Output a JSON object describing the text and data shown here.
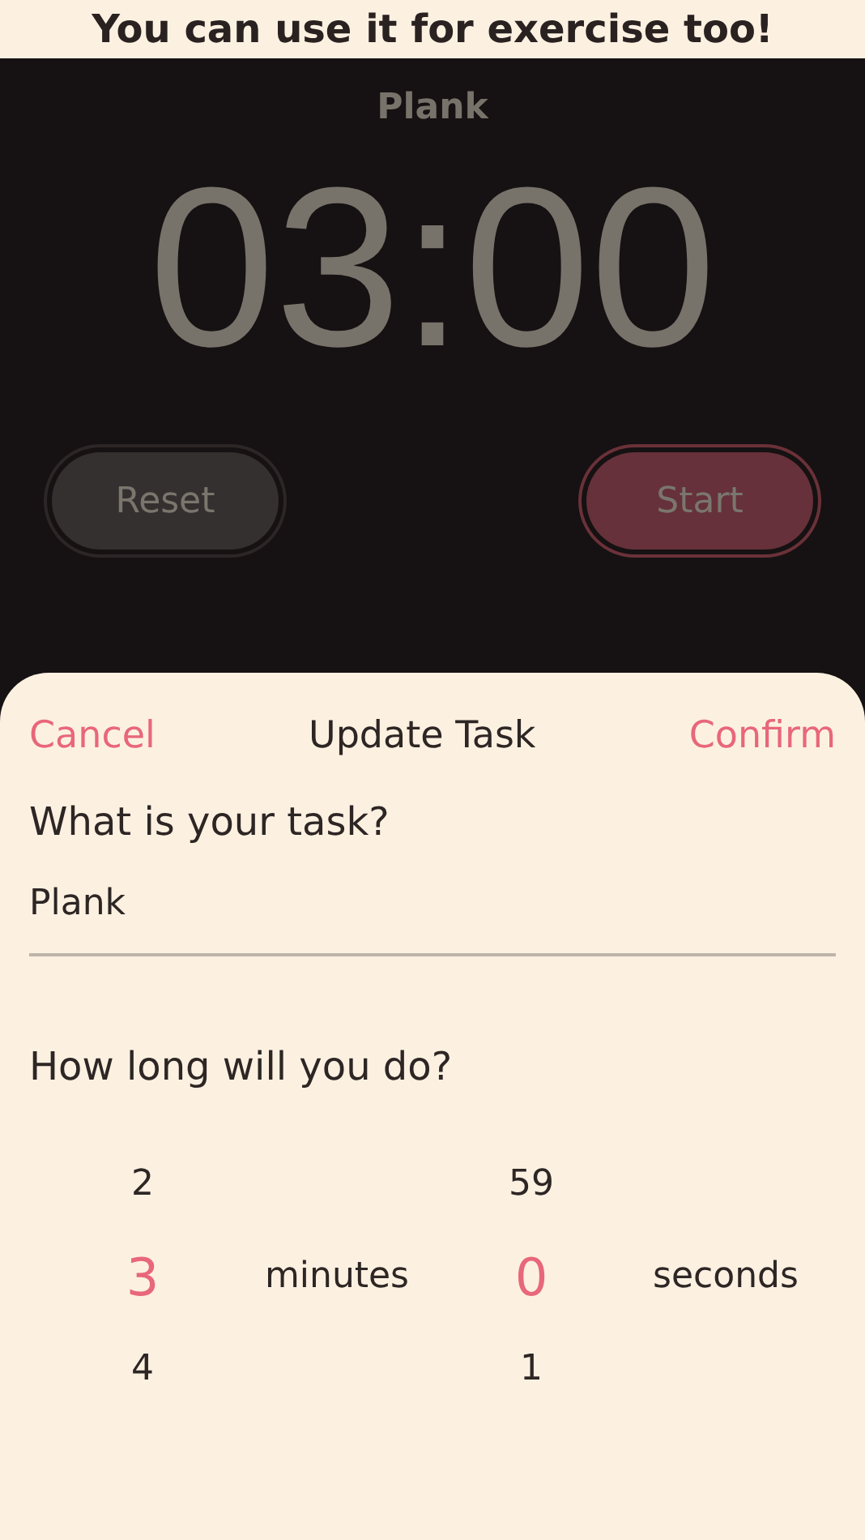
{
  "caption": "You can use it for exercise too!",
  "timer": {
    "task": "Plank",
    "time": "03:00",
    "buttons": [
      {
        "label": "Reset",
        "kind": "secondary"
      },
      {
        "label": "Start",
        "kind": "primary"
      }
    ]
  },
  "sheet": {
    "cancel": "Cancel",
    "title": "Update Task",
    "confirm": "Confirm",
    "task_question": "What is your task?",
    "task_value": "Plank",
    "duration_question": "How long will you do?",
    "pickers": [
      {
        "unit": "minutes",
        "options": [
          {
            "label": "2",
            "selected": false
          },
          {
            "label": "3",
            "selected": true
          },
          {
            "label": "4",
            "selected": false
          }
        ]
      },
      {
        "unit": "seconds",
        "options": [
          {
            "label": "59",
            "selected": false
          },
          {
            "label": "0",
            "selected": true
          },
          {
            "label": "1",
            "selected": false
          }
        ]
      }
    ]
  }
}
